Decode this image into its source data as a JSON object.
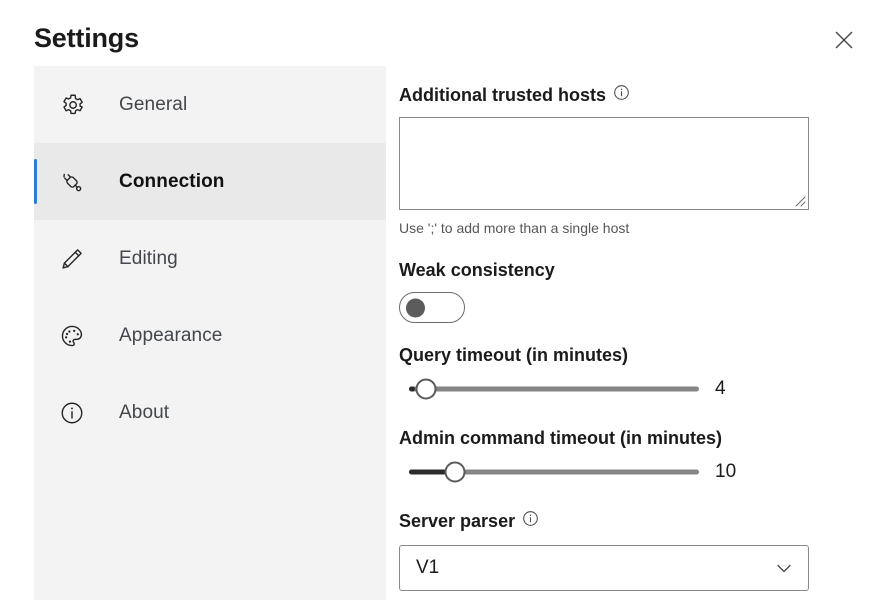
{
  "window": {
    "title": "Settings",
    "close_label": "Close"
  },
  "sidebar": {
    "items": [
      {
        "label": "General",
        "icon": "gear-icon",
        "selected": false
      },
      {
        "label": "Connection",
        "icon": "plug-icon",
        "selected": true
      },
      {
        "label": "Editing",
        "icon": "pencil-icon",
        "selected": false
      },
      {
        "label": "Appearance",
        "icon": "palette-icon",
        "selected": false
      },
      {
        "label": "About",
        "icon": "info-circle-icon",
        "selected": false
      }
    ]
  },
  "content": {
    "trusted_hosts": {
      "label": "Additional trusted hosts",
      "info_icon": "info-icon",
      "value": "",
      "placeholder": "",
      "hint": "Use ';' to add more than a single host"
    },
    "weak_consistency": {
      "label": "Weak consistency",
      "state": "off"
    },
    "query_timeout": {
      "label": "Query timeout (in minutes)",
      "value": "4",
      "fill_percent": 2,
      "thumb_percent": 6
    },
    "admin_timeout": {
      "label": "Admin command timeout (in minutes)",
      "value": "10",
      "fill_percent": 13,
      "thumb_percent": 16
    },
    "server_parser": {
      "label": "Server parser",
      "info_icon": "info-icon",
      "value": "V1",
      "chevron": "chevron-down-icon"
    }
  },
  "colors": {
    "accent": "#2b7cd3",
    "sidebar_bg": "#f3f3f3",
    "sidebar_selected_bg": "#e9e9e9",
    "text": "#1b1b1b",
    "muted_text": "#575757",
    "track": "#868686",
    "fill": "#2b2b2b"
  }
}
